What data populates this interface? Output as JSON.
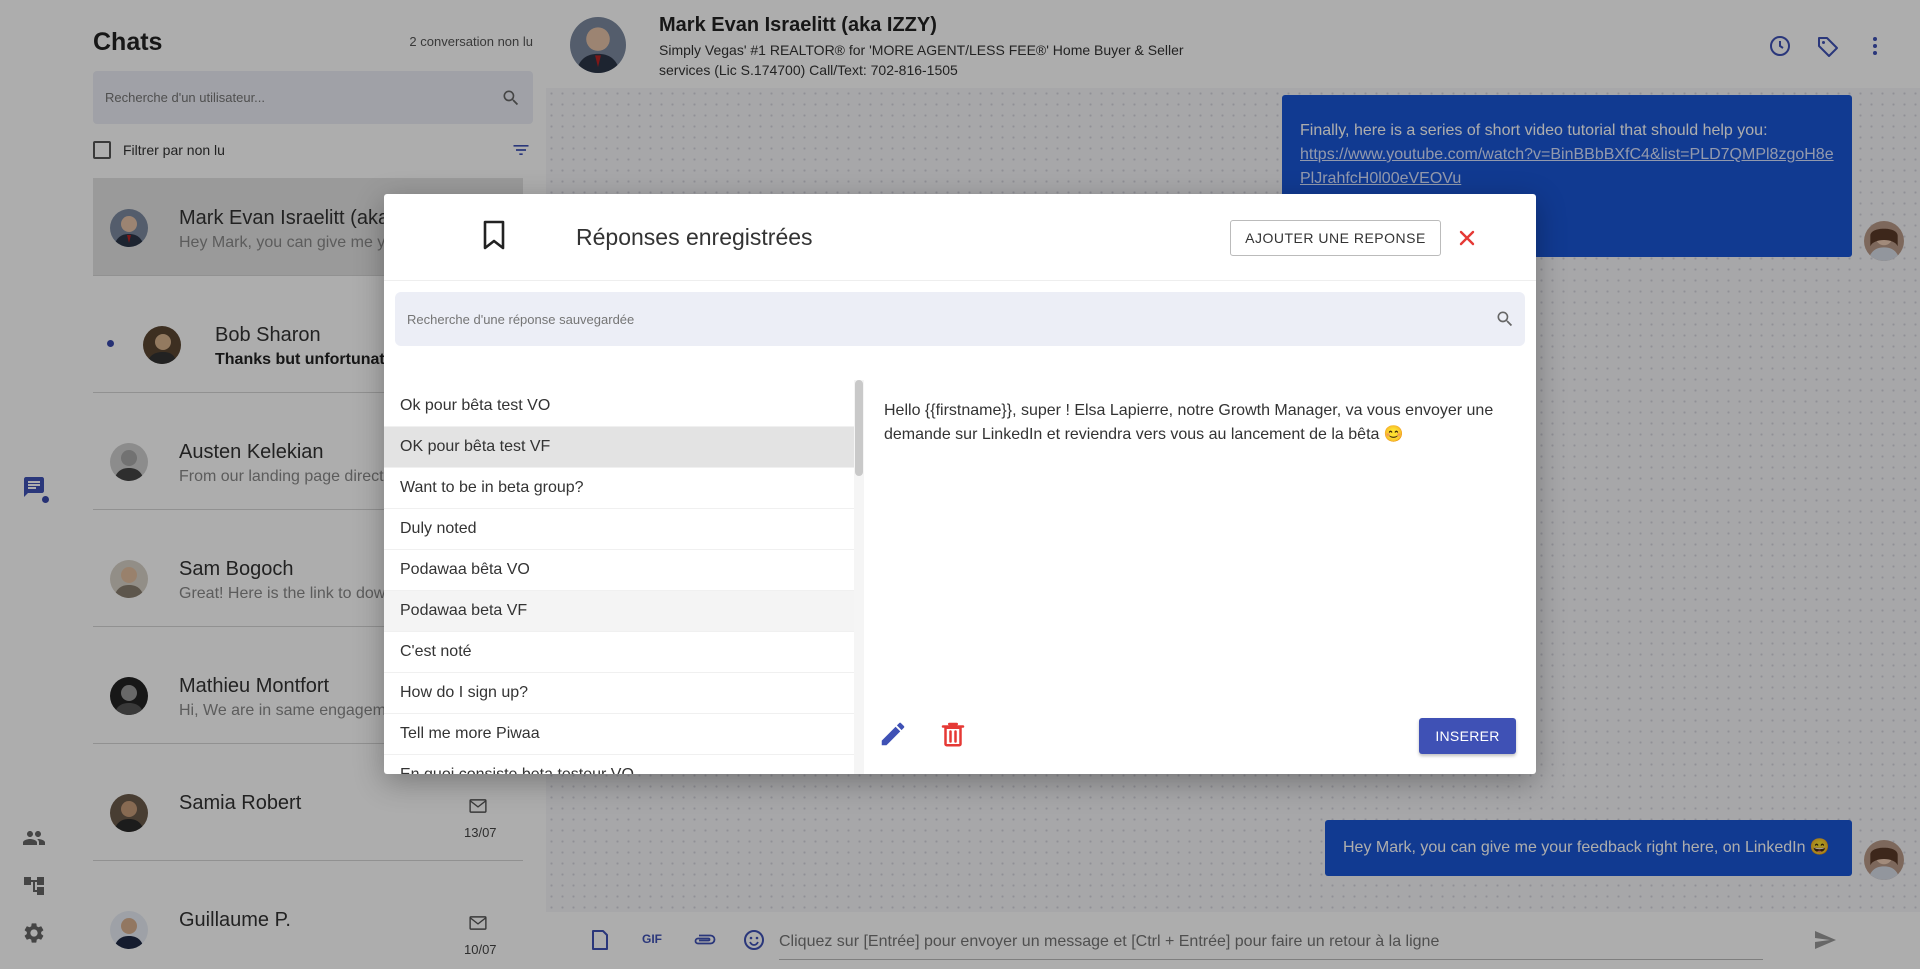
{
  "sidebar": {
    "title": "Chats",
    "unread_count": "2 conversation non lu",
    "search_placeholder": "Recherche d'un utilisateur...",
    "filter_label": "Filtrer par non lu",
    "conversations": [
      {
        "name": "Mark Evan Israelitt (aka IZZY)",
        "preview": "Hey Mark, you can give me your feedback right here, on LinkedIn"
      },
      {
        "name": "Bob Sharon",
        "preview": "Thanks but unfortunately"
      },
      {
        "name": "Austen Kelekian",
        "preview": "From our landing page directly"
      },
      {
        "name": "Sam Bogoch",
        "preview": "Great! Here is the link to download"
      },
      {
        "name": "Mathieu Montfort",
        "preview": "Hi, We are in same engagement group"
      },
      {
        "name": "Samia Robert",
        "date": "13/07"
      },
      {
        "name": "Guillaume P.",
        "date": "10/07"
      }
    ]
  },
  "chat": {
    "contact_name": "Mark Evan Israelitt (aka IZZY)",
    "contact_headline": "Simply Vegas' #1 REALTOR® for 'MORE AGENT/LESS FEE®' Home Buyer & Seller services (Lic S.174700) Call/Text: 702-816-1505",
    "message_1_text": "Finally, here is a series of short video tutorial that should help you:",
    "message_1_link": "https://www.youtube.com/watch?v=BinBBbBXfC4&list=PLD7QMPl8zgoH8ePlJrahfcH0l00eVEOVu",
    "message_2_text": "Hey Mark, you can give me your feedback right here, on LinkedIn 😄",
    "composer_placeholder": "Cliquez sur [Entrée] pour envoyer un message et [Ctrl + Entrée] pour faire un retour à la ligne",
    "gif_label": "GIF"
  },
  "modal": {
    "title": "Réponses enregistrées",
    "add_button": "AJOUTER UNE REPONSE",
    "search_placeholder": "Recherche d'une réponse sauvegardée",
    "responses": [
      "Ok pour bêta test VO",
      "OK pour bêta test VF",
      "Want to be in beta group?",
      "Duly noted",
      "Podawaa bêta VO",
      "Podawaa beta VF",
      "C'est noté",
      "How do I sign up?",
      "Tell me more Piwaa",
      "En quoi consiste beta testeur VO"
    ],
    "selected_index": 1,
    "preview_text": "Hello {{firstname}}, super ! Elsa Lapierre, notre Growth Manager, va vous envoyer une demande sur LinkedIn et reviendra vers vous au lancement de la bêta 😊",
    "insert_button": "INSERER"
  },
  "colors": {
    "accent": "#3f51b5",
    "bubble": "#1a56d6",
    "danger": "#e53935"
  }
}
